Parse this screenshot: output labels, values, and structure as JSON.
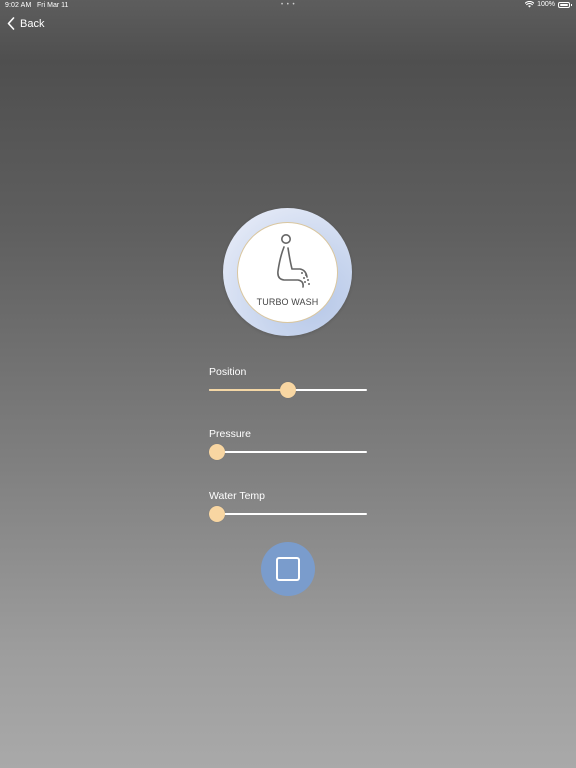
{
  "status_bar": {
    "time": "9:02 AM",
    "date": "Fri Mar 11",
    "dots": "• • •",
    "battery": "100%",
    "icons": [
      "wifi-icon",
      "battery-icon"
    ]
  },
  "nav": {
    "back_label": "Back",
    "back_icon": "chevron-left-icon"
  },
  "mode": {
    "label": "TURBO WASH",
    "icon": "seated-person-spray-icon",
    "ring_color": "#c9d6ee",
    "border_color": "#d9c69f"
  },
  "sliders": [
    {
      "id": "position",
      "label": "Position",
      "value": 0.5
    },
    {
      "id": "pressure",
      "label": "Pressure",
      "value": 0.0
    },
    {
      "id": "water_temp",
      "label": "Water Temp",
      "value": 0.0
    }
  ],
  "stop_button": {
    "icon": "stop-icon",
    "color": "#7a9ccc"
  },
  "colors": {
    "slider_accent": "#f8d6a2",
    "track": "#ffffff"
  }
}
